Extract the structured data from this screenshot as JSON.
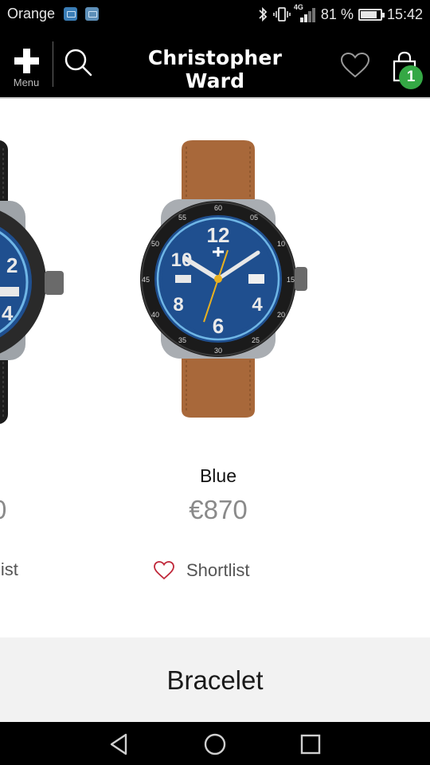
{
  "status_bar": {
    "carrier": "Orange",
    "network": "4G",
    "battery": "81 %",
    "time": "15:42",
    "icons": [
      "app-notification-icon",
      "image-notification-icon",
      "bluetooth-icon",
      "vibrate-icon",
      "signal-icon",
      "battery-icon"
    ]
  },
  "header": {
    "menu_label": "Menu",
    "brand": "Christopher Ward",
    "bag_count": "1",
    "icons": [
      "plus-icon",
      "search-icon",
      "heart-icon",
      "shopping-bag-icon"
    ]
  },
  "products": [
    {
      "name": "",
      "price": "0",
      "shortlist_label": "list"
    },
    {
      "name": "Blue",
      "price": "€870",
      "shortlist_label": "Shortlist"
    }
  ],
  "bracelet": {
    "label": "Bracelet"
  },
  "colors": {
    "header_bg": "#000000",
    "badge_green": "#35a845",
    "price_gray": "#8a8a8a",
    "dial_blue": "#1f4f8f",
    "strap_brown": "#a8683a"
  }
}
